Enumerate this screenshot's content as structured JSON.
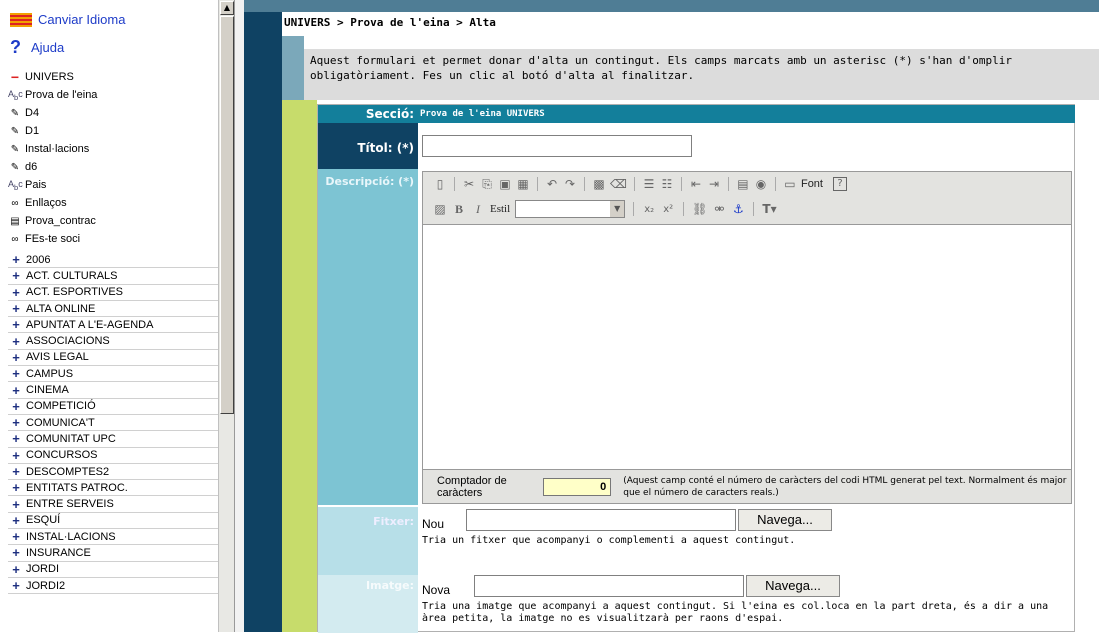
{
  "sidebar": {
    "language_link": "Canviar Idioma",
    "help_link": "Ajuda",
    "tree": [
      {
        "icon": "minus-icon",
        "label": "UNIVERS"
      },
      {
        "icon": "abc-icon",
        "label": "Prova de l'eina"
      },
      {
        "icon": "pencil-icon",
        "label": "D4"
      },
      {
        "icon": "pencil-icon",
        "label": "D1"
      },
      {
        "icon": "pencil-icon",
        "label": "Instal·lacions"
      },
      {
        "icon": "pencil-icon",
        "label": "d6"
      },
      {
        "icon": "abc-icon",
        "label": "Pais"
      },
      {
        "icon": "link-icon",
        "label": "Enllaços"
      },
      {
        "icon": "form-icon",
        "label": "Prova_contrac"
      },
      {
        "icon": "link-icon",
        "label": "FEs-te soci"
      }
    ],
    "categories": [
      "2006",
      "ACT. CULTURALS",
      "ACT. ESPORTIVES",
      "ALTA ONLINE",
      "APUNTAT A L'E-AGENDA",
      "ASSOCIACIONS",
      "AVIS LEGAL",
      "CAMPUS",
      "CINEMA",
      "COMPETICIÓ",
      "COMUNICA'T",
      "COMUNITAT UPC",
      "CONCURSOS",
      "DESCOMPTES2",
      "ENTITATS PATROC.",
      "ENTRE SERVEIS",
      "ESQUÍ",
      "INSTAL·LACIONS",
      "INSURANCE",
      "JORDI",
      "JORDI2"
    ]
  },
  "breadcrumb": "UNIVERS > Prova de l'eina > Alta",
  "intro": "Aquest formulari et permet donar d'alta un contingut. Els camps marcats amb un asterisc (*) s'han d'omplir obligatòriament. Fes un clic al botó d'alta al finalitzar.",
  "form": {
    "seccio_label": "Secció:",
    "seccio_value": "Prova de l'eina  UNIVERS",
    "titol_label": "Títol: (*)",
    "descripcio_label": "Descripció: (*)",
    "toolbar": {
      "font_label": "Font",
      "estil_label": "Estil"
    },
    "counter_label": "Comptador de caràcters",
    "counter_value": "0",
    "counter_note": "(Aquest camp conté el número de caràcters del codi HTML generat pel text. Normalment és major que el número de caracters reals.)",
    "fitxer_label": "Fitxer:",
    "fitxer_nou": "Nou",
    "fitxer_button": "Navega...",
    "fitxer_help": "Tria un fitxer que acompanyi o complementi a aquest contingut.",
    "imatge_label": "Imatge:",
    "imatge_nova": "Nova",
    "imatge_button": "Navega...",
    "imatge_help": "Tria una imatge que acompanyi a aquest contingut. Si l'eina es col.loca en la part dreta, és a dir a una àrea petita, la imatge no es visualitzarà per raons d'espai."
  }
}
